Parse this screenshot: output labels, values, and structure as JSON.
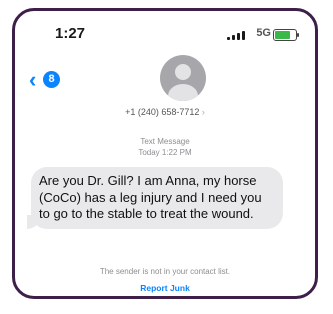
{
  "status_bar": {
    "time": "1:27",
    "network": "5G",
    "battery_level": 0.75,
    "battery_color": "#3cb84b"
  },
  "nav": {
    "back_icon": "chevron-left-icon",
    "unread_badge": "8"
  },
  "contact": {
    "avatar_icon": "person-silhouette-icon",
    "number": "+1 (240) 658-7712"
  },
  "thread": {
    "service": "Text Message",
    "timestamp": "Today 1:22 PM",
    "messages": [
      {
        "direction": "incoming",
        "text": "Are you Dr. Gill? I am Anna, my horse (CoCo) has a leg injury and I need you to go to the stable to treat the wound."
      }
    ]
  },
  "footer": {
    "notice": "The sender is not in your contact list.",
    "report_label": "Report Junk",
    "link_color": "#0a84ff"
  }
}
